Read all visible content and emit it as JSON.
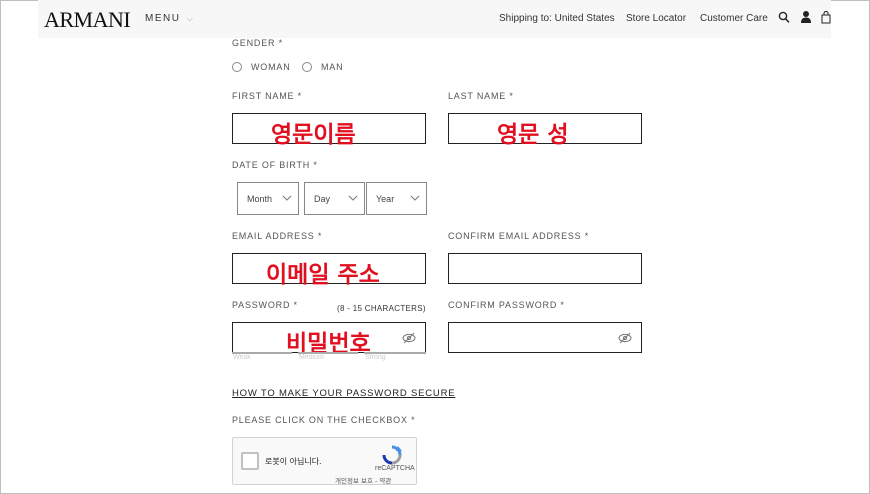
{
  "header": {
    "logo": "ARMANI",
    "menu_label": "MENU",
    "shipping": "Shipping to: United States",
    "store_locator": "Store Locator",
    "customer_care": "Customer Care"
  },
  "form": {
    "gender_label": "GENDER *",
    "gender_woman": "WOMAN",
    "gender_man": "MAN",
    "first_name_label": "FIRST NAME *",
    "first_name_value": "영문이름",
    "last_name_label": "LAST NAME *",
    "last_name_value": "영문 성",
    "dob_label": "DATE OF BIRTH *",
    "dob_month": "Month",
    "dob_day": "Day",
    "dob_year": "Year",
    "email_label": "EMAIL ADDRESS *",
    "email_value": "이메일 주소",
    "confirm_email_label": "CONFIRM EMAIL ADDRESS *",
    "password_label": "PASSWORD *",
    "password_hint": "(8 - 15 CHARACTERS)",
    "password_value": "비밀번호",
    "confirm_password_label": "CONFIRM PASSWORD *",
    "strength_weak": "Weak",
    "strength_medium": "Medium",
    "strength_strong": "Strong",
    "password_secure_link": "HOW TO MAKE YOUR PASSWORD SECURE",
    "checkbox_label": "PLEASE CLICK ON THE CHECKBOX *"
  },
  "captcha": {
    "text": "로봇이 아닙니다.",
    "brand": "reCAPTCHA",
    "privacy": "개인정보 보호 - 약관"
  },
  "colors": {
    "annotation_red": "#e01020",
    "header_bg": "#f7f7f7"
  }
}
